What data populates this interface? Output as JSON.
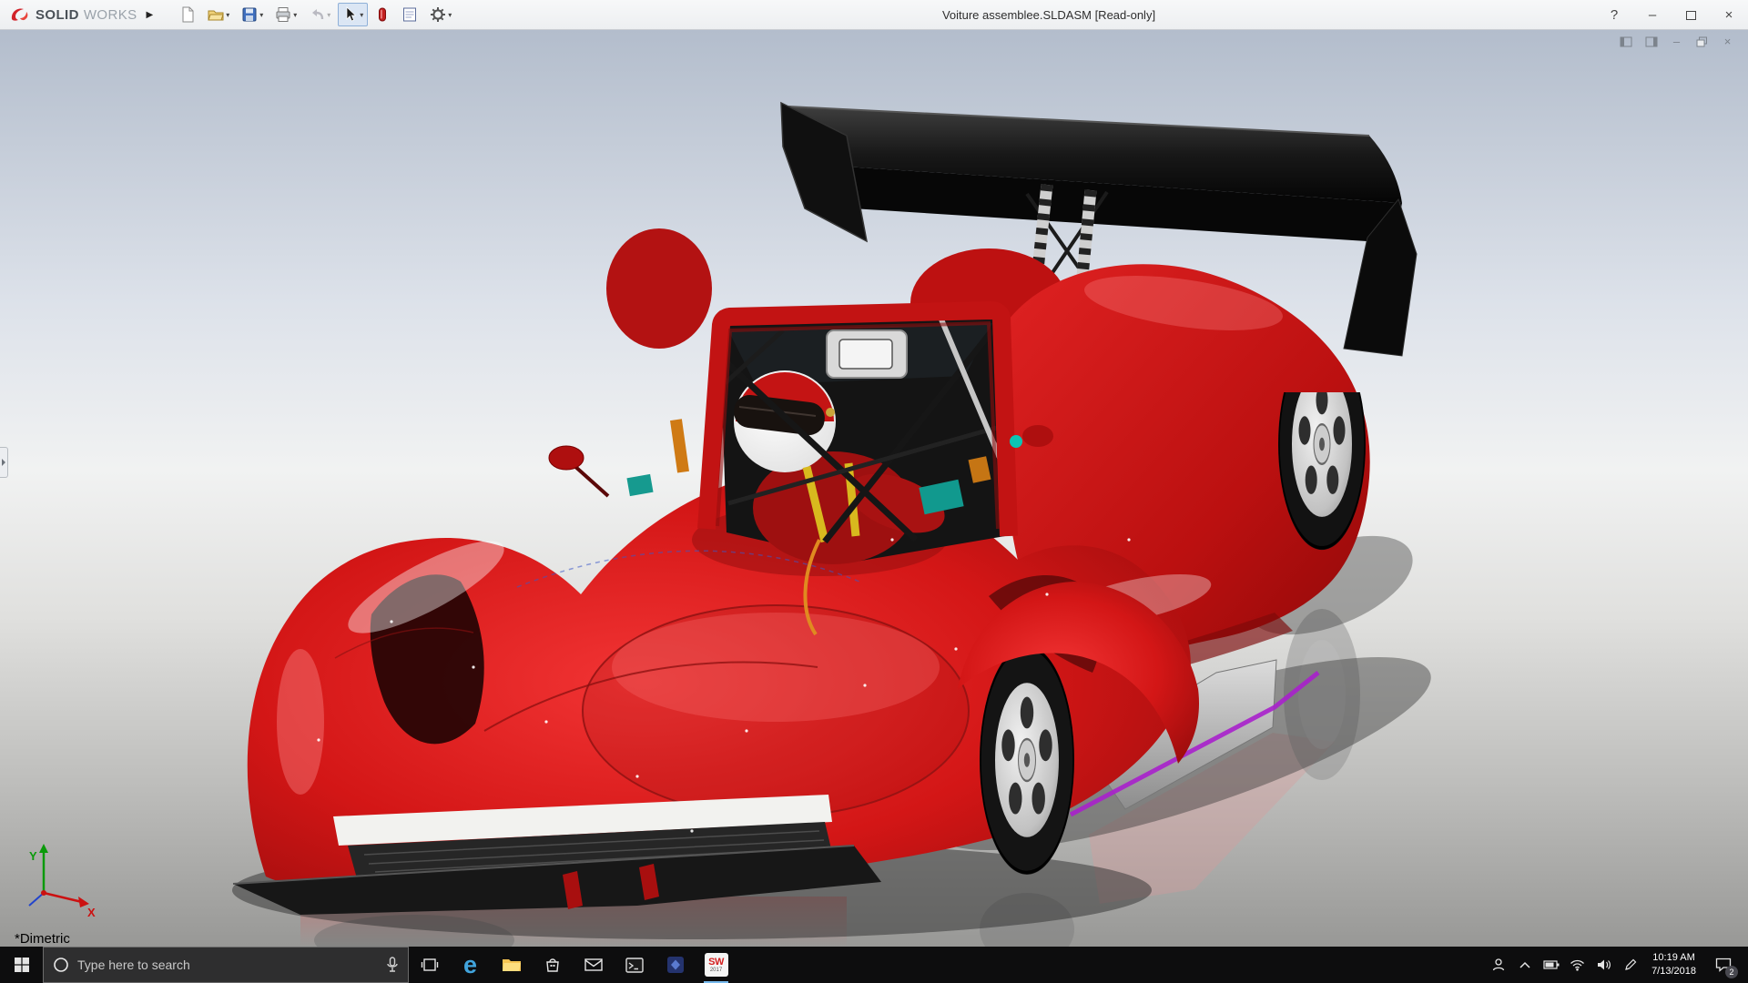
{
  "colors": {
    "car_red": "#c81414",
    "wing_black": "#0d0d0d",
    "titlebar_bg": "#f0f1f2",
    "taskbar_bg": "#0d0d0e",
    "solidworks_red": "#d2232a",
    "taskbar_accent": "#76b9ed",
    "background_top": "#b3bdcc"
  },
  "titlebar": {
    "brand_solid": "SOLID",
    "brand_works": "WORKS",
    "document_title": "Voiture assemblee.SLDASM [Read-only]",
    "help": "?",
    "minimize": "–",
    "close": "×"
  },
  "toolbar": {
    "items": [
      "new-document",
      "open",
      "save",
      "print",
      "undo",
      "select",
      "appearance",
      "design-binder",
      "options"
    ]
  },
  "document_window": {
    "minimize": "–",
    "close": "×"
  },
  "viewport": {
    "view_orientation": "*Dimetric",
    "triad_x": "X",
    "triad_y": "Y"
  },
  "taskbar": {
    "search_placeholder": "Type here to search",
    "time": "10:19 AM",
    "date": "7/13/2018",
    "notification_badge": "2"
  }
}
